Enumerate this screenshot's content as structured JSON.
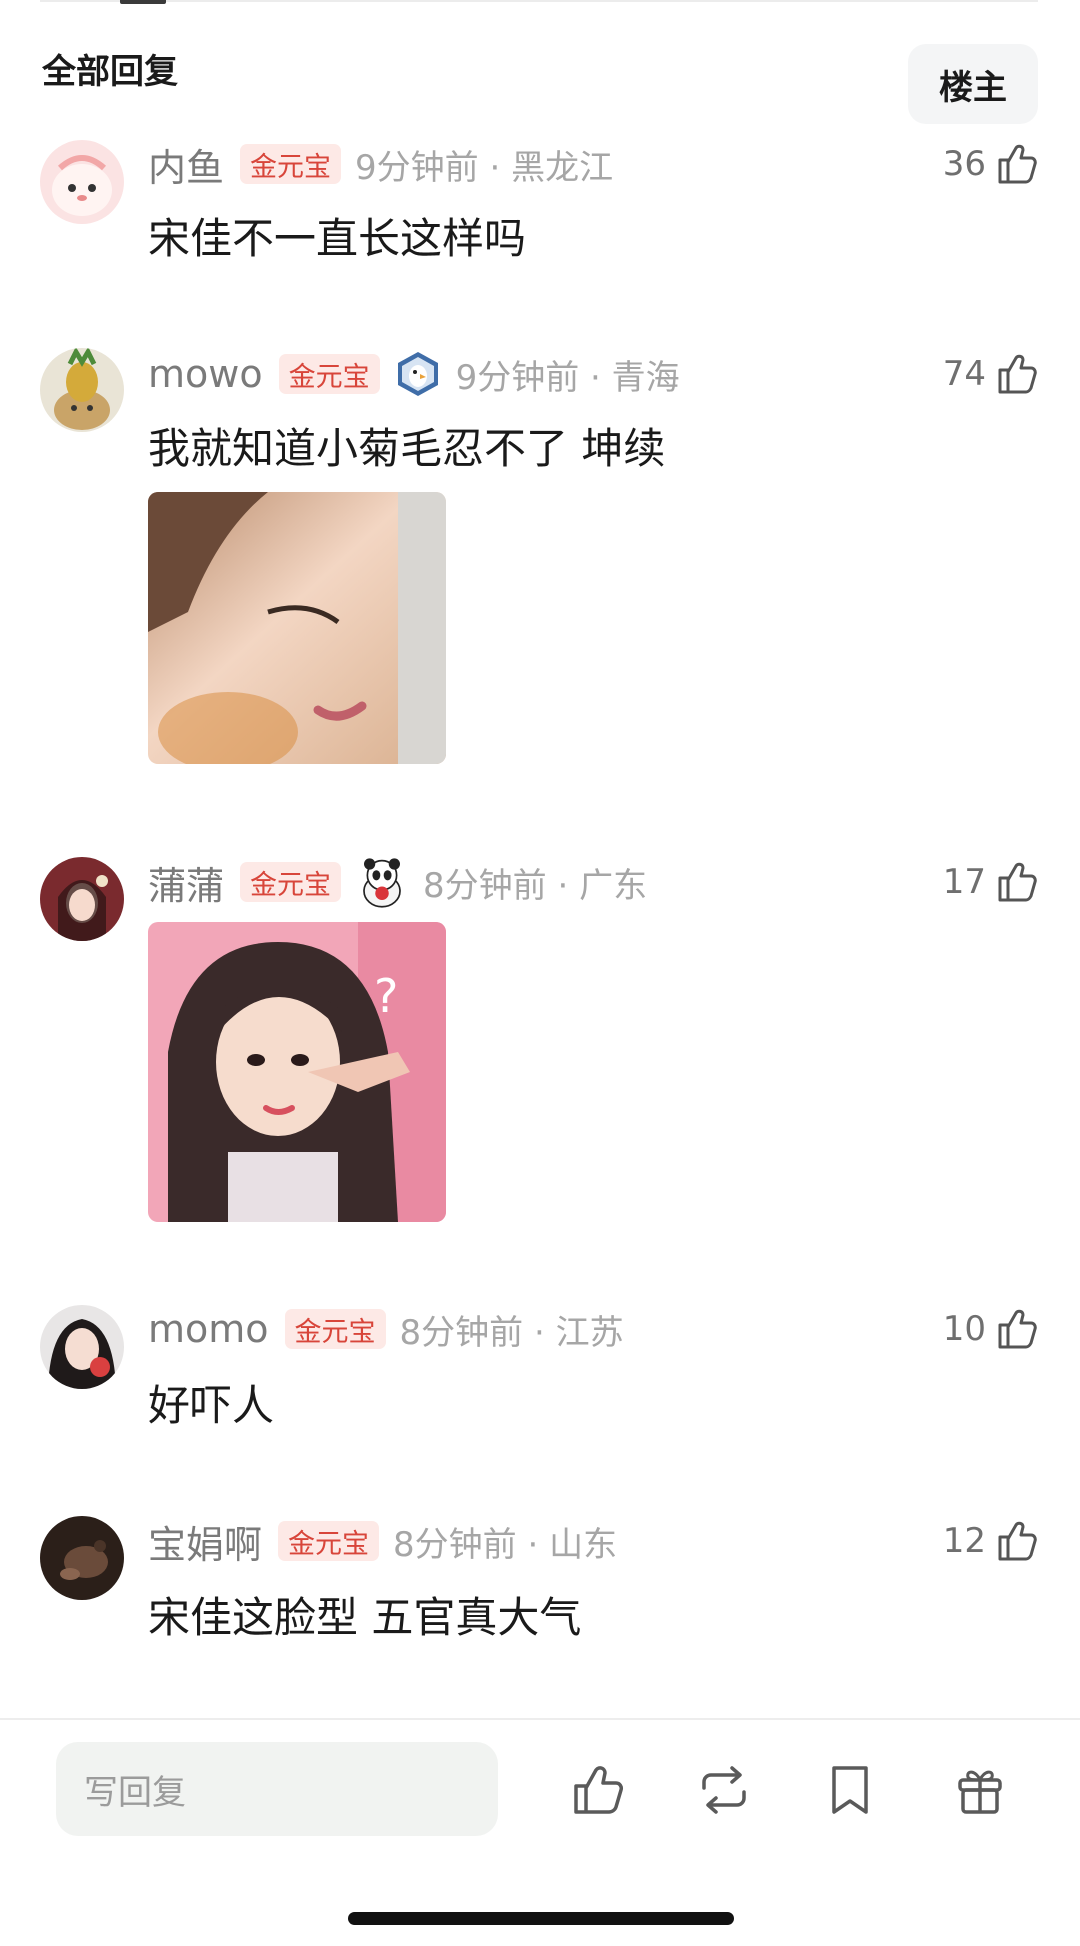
{
  "header": {
    "title": "全部回复",
    "op_button": "楼主"
  },
  "comments": [
    {
      "username": "内鱼",
      "badge": "金元宝",
      "has_medal": false,
      "time_location": "9分钟前 · 黑龙江",
      "likes": "36",
      "text": "宋佳不一直长这样吗",
      "has_image": false
    },
    {
      "username": "mowo",
      "badge": "金元宝",
      "has_medal": true,
      "medal_icon": "eagle-medal-icon",
      "time_location": "9分钟前 · 青海",
      "likes": "74",
      "text": "我就知道小菊毛忍不了 坤续",
      "has_image": true
    },
    {
      "username": "蒲蒲",
      "badge": "金元宝",
      "has_medal": true,
      "medal_icon": "panda-medal-icon",
      "time_location": "8分钟前 · 广东",
      "likes": "17",
      "text": "",
      "has_image": true
    },
    {
      "username": "momo",
      "badge": "金元宝",
      "has_medal": false,
      "time_location": "8分钟前 · 江苏",
      "likes": "10",
      "text": "好吓人",
      "has_image": false
    },
    {
      "username": "宝娟啊",
      "badge": "金元宝",
      "has_medal": false,
      "time_location": "8分钟前 · 山东",
      "likes": "12",
      "text": "宋佳这脸型 五官真大气",
      "has_image": false
    }
  ],
  "bottom_bar": {
    "reply_placeholder": "写回复",
    "icons": [
      "thumbs-up-icon",
      "repost-icon",
      "bookmark-icon",
      "gift-icon"
    ]
  },
  "colors": {
    "badge_bg": "#fde9e6",
    "badge_text": "#d8453a",
    "meta_gray": "#a6a6a6",
    "username_gray": "#7a7a7a"
  }
}
